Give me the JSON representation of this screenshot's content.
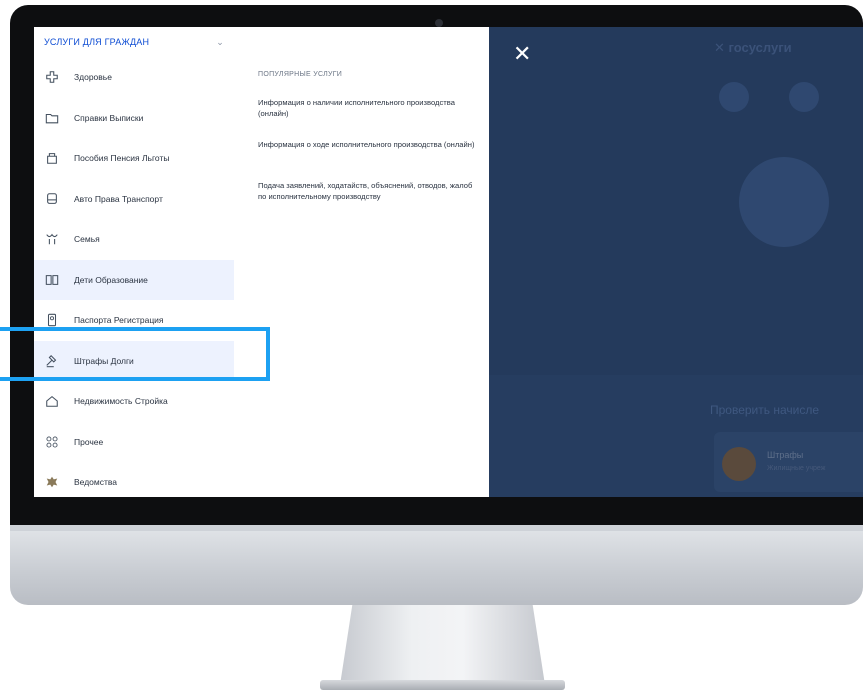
{
  "sidebar": {
    "header": "УСЛУГИ ДЛЯ ГРАЖДАН",
    "items": [
      {
        "label": "Здоровье",
        "icon": "health-icon"
      },
      {
        "label": "Справки Выписки",
        "icon": "folder-icon"
      },
      {
        "label": "Пособия Пенсия Льготы",
        "icon": "wallet-icon"
      },
      {
        "label": "Авто Права Транспорт",
        "icon": "car-icon"
      },
      {
        "label": "Семья",
        "icon": "family-icon"
      },
      {
        "label": "Дети Образование",
        "icon": "book-icon"
      },
      {
        "label": "Паспорта Регистрация",
        "icon": "passport-icon"
      },
      {
        "label": "Штрафы Долги",
        "icon": "gavel-icon"
      },
      {
        "label": "Недвижимость Стройка",
        "icon": "house-icon"
      },
      {
        "label": "Прочее",
        "icon": "grid-icon"
      },
      {
        "label": "Ведомства",
        "icon": "emblem-icon"
      }
    ],
    "active_index": 5,
    "highlighted_index": 7
  },
  "popular": {
    "title": "ПОПУЛЯРНЫЕ УСЛУГИ",
    "services": [
      "Информация о наличии исполнительного производства (онлайн)",
      "Информация о ходе исполнительного производства (онлайн)",
      "Подача заявлений, ходатайств, объяснений, отводов, жалоб по исполнительному производству"
    ]
  },
  "background": {
    "brand": "госуслуги",
    "section_title": "Проверить начисле",
    "card_title": "Штрафы",
    "card_subtitle": "Жилищные учреж"
  },
  "colors": {
    "accent": "#0d4cd3",
    "overlay": "#243a5c",
    "highlight": "#1da1f2"
  }
}
